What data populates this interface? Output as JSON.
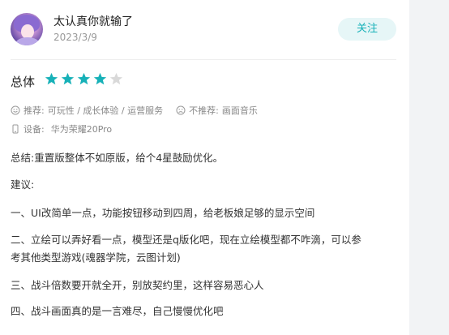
{
  "review": {
    "username": "太认真你就输了",
    "date": "2023/3/9",
    "follow_label": "关注",
    "rating_label": "总体",
    "rating_value": 4,
    "rating_max": 5,
    "recommend_prefix": "推荐:",
    "recommend_items": "可玩性 / 成长体验 / 运营服务",
    "not_recommend_prefix": "不推荐:",
    "not_recommend_items": "画面音乐",
    "device_prefix": "设备:",
    "device_name": "华为荣耀20Pro",
    "paragraphs": {
      "summary": "总结:重置版整体不如原版，给个4星鼓励优化。",
      "suggest": "建议:",
      "item1": "一、UI改简单一点，功能按钮移动到四周，给老板娘足够的显示空间",
      "item2_line1": "二、立绘可以弄好看一点，模型还是q版化吧，现在立绘模型都不咋滴，可以参",
      "item2_line2": "考其他类型游戏(魂器学院，云图计划)",
      "item3": "三、战斗倍数要开就全开，别放契约里，这样容易恶心人",
      "item4": "四、战斗画面真的是一言难尽，自己慢慢优化吧"
    }
  },
  "colors": {
    "accent": "#17b1b8",
    "star_filled": "#17b1b8",
    "star_empty": "#d9d9d9"
  }
}
